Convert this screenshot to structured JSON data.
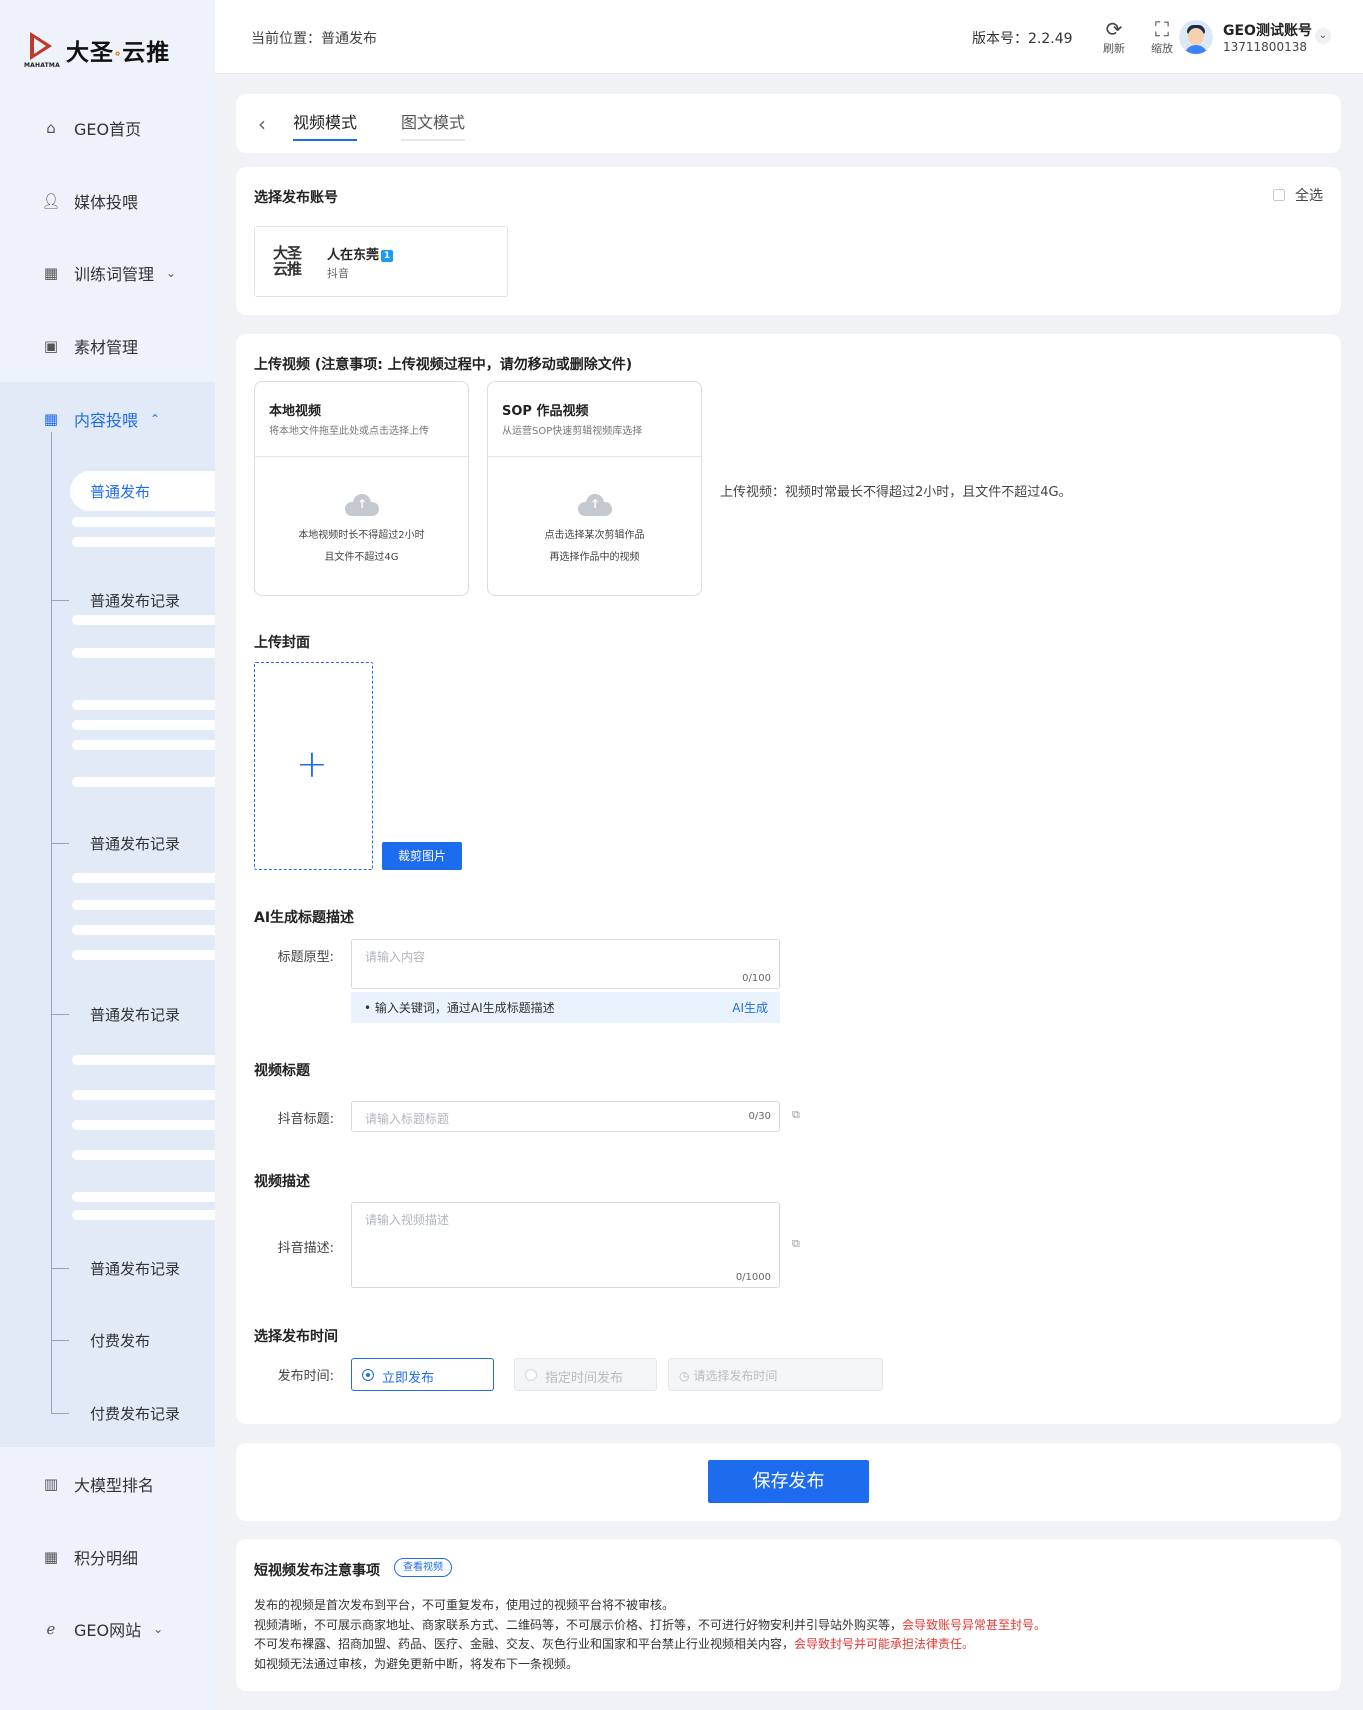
{
  "logo": {
    "brand_left": "大圣",
    "brand_right": "云推",
    "sub": "MAHATMA"
  },
  "sidebar": {
    "items": [
      {
        "label": "GEO首页",
        "icon": "home-icon"
      },
      {
        "label": "媒体投喂",
        "icon": "user-icon"
      },
      {
        "label": "训练词管理",
        "icon": "grid-icon"
      },
      {
        "label": "素材管理",
        "icon": "image-icon"
      },
      {
        "label": "内容投喂",
        "icon": "grid-icon"
      },
      {
        "label": "大模型排名",
        "icon": "chart-icon"
      },
      {
        "label": "积分明细",
        "icon": "grid-icon"
      },
      {
        "label": "GEO网站",
        "icon": "browser-icon"
      }
    ],
    "sub_items": [
      "普通发布",
      "普通发布记录",
      "普通发布记录",
      "普通发布记录",
      "普通发布记录",
      "付费发布",
      "付费发布记录"
    ]
  },
  "header": {
    "crumb": "当前位置：普通发布",
    "version": "版本号：2.2.49",
    "refresh": "刷新",
    "zoom": "缩放",
    "user_name": "GEO测试账号",
    "user_phone": "13711800138"
  },
  "tabs": {
    "video": "视频模式",
    "image_text": "图文模式"
  },
  "account_section": {
    "title": "选择发布账号",
    "select_all": "全选",
    "account_logo": "大圣云推",
    "account_name": "人在东莞",
    "account_badge": "1",
    "account_platform": "抖音"
  },
  "upload": {
    "title": "上传视频 (注意事项: 上传视频过程中，请勿移动或删除文件)",
    "local": {
      "title": "本地视频",
      "sub": "将本地文件拖至此处或点击选择上传",
      "hint1": "本地视频时长不得超过2小时",
      "hint2": "且文件不超过4G"
    },
    "sop": {
      "title": "SOP 作品视频",
      "sub": "从运营SOP快速剪辑视频库选择",
      "hint1": "点击选择某次剪辑作品",
      "hint2": "再选择作品中的视频"
    },
    "hint": "上传视频：视频时常最长不得超过2小时，且文件不超过4G。"
  },
  "cover": {
    "title": "上传封面",
    "crop_label": "裁剪图片"
  },
  "ai": {
    "title": "AI生成标题描述",
    "label": "标题原型:",
    "placeholder": "请输入内容",
    "count": "0/100",
    "tip": "• 输入关键词，通过AI生成标题描述",
    "generate": "AI生成"
  },
  "video_title": {
    "title": "视频标题",
    "label": "抖音标题:",
    "placeholder": "请输入标题标题",
    "count": "0/30"
  },
  "video_desc": {
    "title": "视频描述",
    "label": "抖音描述:",
    "placeholder": "请输入视频描述",
    "count": "0/1000"
  },
  "publish_time": {
    "title": "选择发布时间",
    "label": "发布时间:",
    "immediate": "立即发布",
    "scheduled": "指定时间发布",
    "pick_placeholder": "请选择发布时间"
  },
  "save_label": "保存发布",
  "notes": {
    "title": "短视频发布注意事项",
    "view_btn": "查看视频",
    "line1": "发布的视频是首次发布到平台，不可重复发布，使用过的视频平台将不被审核。",
    "line2a": "视频清晰，不可展示商家地址、商家联系方式、二维码等，不可展示价格、打折等，不可进行好物安利并引导站外购买等，",
    "line2b": "会导致账号异常甚至封号。",
    "line3a": "不可发布裸露、招商加盟、药品、医疗、金融、交友、灰色行业和国家和平台禁止行业视频相关内容，",
    "line3b": "会导致封号并可能承担法律责任。",
    "line4": "如视频无法通过审核，为避免更新中断，将发布下一条视频。"
  },
  "colors": {
    "accent": "#1d6cf0",
    "warning": "#e53935",
    "sidebar_bg": "#edf2fb"
  }
}
